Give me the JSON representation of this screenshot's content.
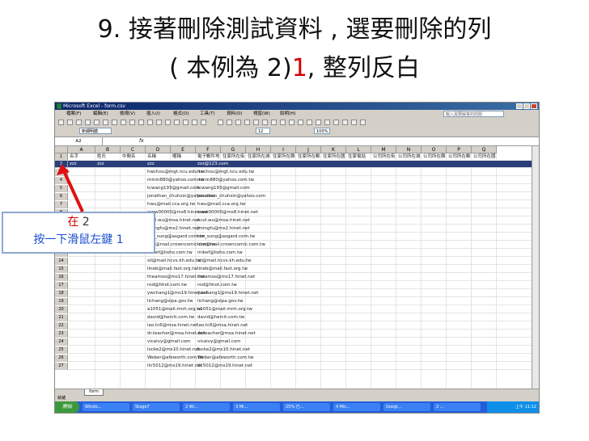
{
  "heading": {
    "line1": "9. 接著刪除測試資料 , 選要刪除的列",
    "line2_prefix": "( 本例為 2)",
    "line2_highlight": "1",
    "line2_suffix": ", 整列反白"
  },
  "window": {
    "title": "Microsoft Excel - form.csv"
  },
  "menu": [
    "檔案(F)",
    "編輯(E)",
    "檢視(V)",
    "插入(I)",
    "格式(O)",
    "工具(T)",
    "資料(D)",
    "視窗(W)",
    "說明(H)"
  ],
  "help_placeholder": "輸入需要解答的問題",
  "toolbar": {
    "font": "新細明體",
    "size": "12",
    "zoom": "100%"
  },
  "formula_bar": {
    "cell_ref": "A2",
    "fx": "fx"
  },
  "columns": [
    "A",
    "B",
    "C",
    "D",
    "E",
    "F",
    "G",
    "H",
    "I",
    "J",
    "K",
    "L",
    "M",
    "N",
    "O",
    "P",
    "Q"
  ],
  "header_row": [
    "名字",
    "姓氏",
    "中間名",
    "名稱",
    "暱稱",
    "電子郵件地",
    "住家所在街",
    "住家所在城",
    "住家所在縣",
    "住家所在郵",
    "住家所在國",
    "住家電話",
    "公司所在街",
    "公司所在城",
    "公司所在縣",
    "公司所在郵",
    "公司所在國"
  ],
  "rows": [
    {
      "num": "2",
      "a": "zzz",
      "b": "zzz",
      "d": "zzz",
      "f": "zzz@123.com",
      "g": ""
    },
    {
      "num": "3",
      "a": "",
      "b": "",
      "d": "hwchou@mgt.ncu.edu.tw",
      "f": "hwchou@mgt.ncu.edu.tw"
    },
    {
      "num": "4",
      "d": "minin880@yahoo.com.tw",
      "f": "minin880@yahoo.com.tw"
    },
    {
      "num": "5",
      "d": "tcwang193@gmail.com",
      "f": "tcwang193@gmail.com"
    },
    {
      "num": "6",
      "d": "jonathan_chuhsin@yahoo.com",
      "f": "jonathan_chuhsin@yahoo.com"
    },
    {
      "num": "7",
      "d": "hwu@mail.cca.org.tw",
      "f": "hwu@mail.cca.org.tw"
    },
    {
      "num": "8",
      "d": "www00000@ms8.hinet.net",
      "f": "www00000@ms8.hinet.net"
    },
    {
      "num": "9",
      "d": "ncol.wu@msa.hinet.net",
      "f": "ncol.wu@msa.hinet.net"
    },
    {
      "num": "10",
      "d": "jmingfu@ms2.hinet.net",
      "f": "jmingfu@ms2.hinet.net"
    },
    {
      "num": "11",
      "d": "ton_sung@asgard.com.tw",
      "f": "ton_sung@asgard.com.tw"
    },
    {
      "num": "12",
      "d": "kim@mail.crowncomic.com.tw",
      "f": "kim@mail.crowncomic.com.tw"
    },
    {
      "num": "13",
      "d": "mikef@lioho.com.tw",
      "f": "mikef@lioho.com.tw"
    },
    {
      "num": "14",
      "d": "sil@mail.hcvs.kh.edu.tw",
      "f": "sil@mail.hcvs.kh.edu.tw"
    },
    {
      "num": "15",
      "d": "lineb@mail.fast.org.tw",
      "f": "lineb@mail.fast.org.tw"
    },
    {
      "num": "16",
      "d": "theamos@ms17.hinet.net",
      "f": "theamos@ms17.hinet.net"
    },
    {
      "num": "17",
      "d": "rod@hhot.com.tw",
      "f": "rod@hhot.com.tw"
    },
    {
      "num": "18",
      "d": "ywchang1@ms19.hinet.net",
      "f": "ywchang1@ms19.hinet.net"
    },
    {
      "num": "19",
      "d": "lichang@sipa.gov.tw",
      "f": "lichang@sipa.gov.tw"
    },
    {
      "num": "20",
      "d": "a1051@mail.mnh.org.tw",
      "f": "a1051@mail.mnh.org.tw"
    },
    {
      "num": "21",
      "d": "david@hercit.com.tw",
      "f": "david@hercit.com.tw"
    },
    {
      "num": "22",
      "d": "lao.tc6@msa.hinet.net",
      "f": "lao.tc6@msa.hinet.net"
    },
    {
      "num": "23",
      "d": "dr.teacher@msa.hinet.net",
      "f": "dr.teacher@msa.hinet.net"
    },
    {
      "num": "24",
      "d": "vicaivy@gmail.com",
      "f": "vicaivy@gmail.com"
    },
    {
      "num": "25",
      "d": "locke2@ms10.hinet.net",
      "f": "locke2@ms10.hinet.net"
    },
    {
      "num": "26",
      "d": "Weber@afeworth.com.tw",
      "f": "Weber@afeworth.com.tw"
    },
    {
      "num": "27",
      "d": "ltc5012@ms19.hinet.net",
      "f": "ltc5012@ms19.hinet.net"
    }
  ],
  "sheet_tab": "form",
  "status_text": "就緒",
  "taskbar": {
    "start": "開始",
    "items": [
      "Windo...",
      "Stage7",
      "2 Wi...",
      "3 Mi...",
      "25% 已...",
      "4 Mic...",
      "Googl...",
      "2 ..."
    ],
    "clock": "上午 11:12"
  },
  "callout": {
    "line1_red": "在",
    "line1_rest": " 2",
    "line2": "按一下滑鼠左鍵 1"
  },
  "colors": {
    "selection": "#2a3f7a",
    "accent_red": "#d40000",
    "callout_blue": "#1a4ecf"
  }
}
